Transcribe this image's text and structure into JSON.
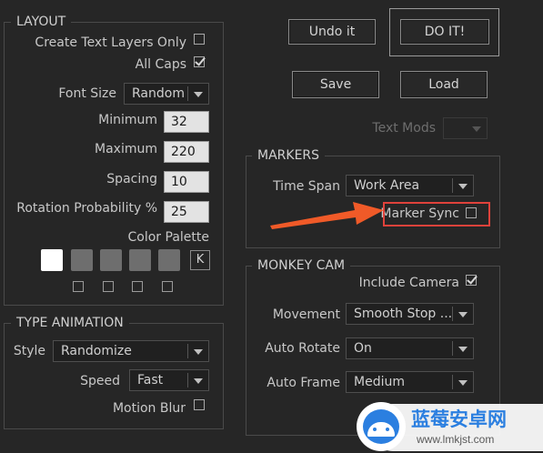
{
  "layout": {
    "title": "LAYOUT",
    "create_text_layers_only": {
      "label": "Create Text Layers Only",
      "checked": false
    },
    "all_caps": {
      "label": "All Caps",
      "checked": true
    },
    "font_size": {
      "label": "Font Size",
      "value": "Random"
    },
    "minimum": {
      "label": "Minimum",
      "value": "32"
    },
    "maximum": {
      "label": "Maximum",
      "value": "220"
    },
    "spacing": {
      "label": "Spacing",
      "value": "10"
    },
    "rotation_probability": {
      "label": "Rotation Probability %",
      "value": "25"
    },
    "color_palette": {
      "label": "Color Palette",
      "swatches": [
        "#ffffff",
        "#6e6e6e",
        "#6e6e6e",
        "#6e6e6e",
        "#6e6e6e"
      ],
      "k_label": "K"
    }
  },
  "type_animation": {
    "title": "TYPE ANIMATION",
    "style": {
      "label": "Style",
      "value": "Randomize"
    },
    "speed": {
      "label": "Speed",
      "value": "Fast"
    },
    "motion_blur": {
      "label": "Motion Blur",
      "checked": false
    }
  },
  "buttons": {
    "undo": "Undo it",
    "do_it": "DO IT!",
    "save": "Save",
    "load": "Load"
  },
  "text_mods": {
    "label": "Text Mods"
  },
  "markers": {
    "title": "MARKERS",
    "time_span": {
      "label": "Time Span",
      "value": "Work Area"
    },
    "marker_sync": {
      "label": "Marker Sync",
      "checked": false
    }
  },
  "monkey_cam": {
    "title": "MONKEY CAM",
    "include_camera": {
      "label": "Include Camera",
      "checked": true
    },
    "movement": {
      "label": "Movement",
      "value": "Smooth Stop ..."
    },
    "auto_rotate": {
      "label": "Auto Rotate",
      "value": "On"
    },
    "auto_frame": {
      "label": "Auto Frame",
      "value": "Medium"
    }
  },
  "annotation": {
    "highlight_color": "#e0423b",
    "arrow_color": "#f05a28"
  },
  "watermark": {
    "brand": "蓝莓安卓网",
    "url": "www.lmkjst.com"
  }
}
